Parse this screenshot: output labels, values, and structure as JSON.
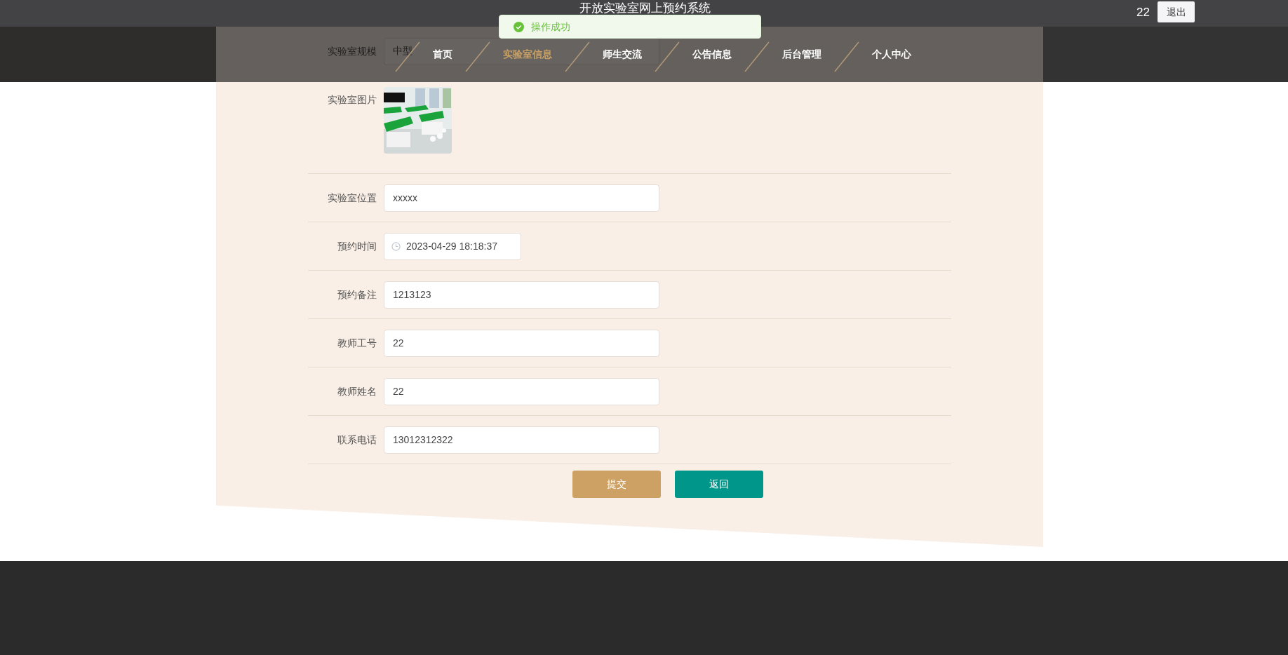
{
  "header": {
    "title": "开放实验室网上预约系统",
    "username": "22",
    "logout_button": "退出"
  },
  "toast": {
    "message": "操作成功"
  },
  "nav": [
    {
      "label": "首页",
      "selected": false
    },
    {
      "label": "实验室信息",
      "selected": true
    },
    {
      "label": "师生交流",
      "selected": false
    },
    {
      "label": "公告信息",
      "selected": false
    },
    {
      "label": "后台管理",
      "selected": false
    },
    {
      "label": "个人中心",
      "selected": false
    }
  ],
  "form": {
    "fields": [
      {
        "kind": "text",
        "label": "实验室规模",
        "value": "中型"
      },
      {
        "label": "实验室图片"
      },
      {
        "kind": "text",
        "label": "实验室位置",
        "value": "xxxxx"
      },
      {
        "kind": "datetime",
        "label": "预约时间",
        "value": "2023-04-29 18:18:37"
      },
      {
        "kind": "text",
        "label": "预约备注",
        "value": "1213123"
      },
      {
        "kind": "text",
        "label": "教师工号",
        "value": "22"
      },
      {
        "kind": "text",
        "label": "教师姓名",
        "value": "22"
      },
      {
        "kind": "text",
        "label": "联系电话",
        "value": "13012312322"
      }
    ],
    "submit_button": "提交",
    "back_button": "返回"
  }
}
